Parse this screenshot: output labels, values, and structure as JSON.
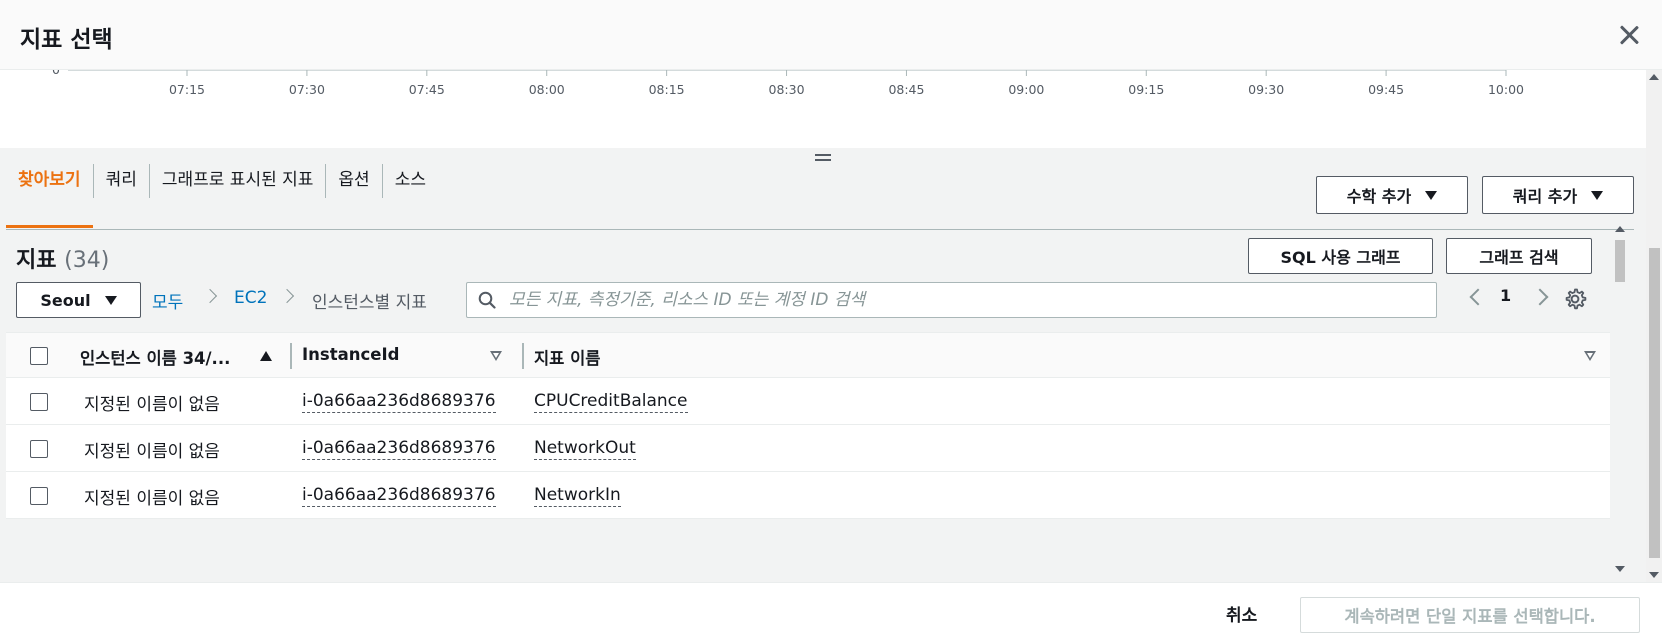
{
  "dialog": {
    "title": "지표 선택",
    "close_label": "×"
  },
  "chart": {
    "y_tick_zero": "0",
    "x_ticks": [
      "07:15",
      "07:30",
      "07:45",
      "08:00",
      "08:15",
      "08:30",
      "08:45",
      "09:00",
      "09:15",
      "09:30",
      "09:45",
      "10:00"
    ]
  },
  "tabs": [
    {
      "label": "찾아보기",
      "active": true
    },
    {
      "label": "쿼리",
      "active": false
    },
    {
      "label": "그래프로 표시된 지표",
      "active": false
    },
    {
      "label": "옵션",
      "active": false
    },
    {
      "label": "소스",
      "active": false
    }
  ],
  "actions": {
    "math_label": "수학 추가",
    "query_label": "쿼리 추가"
  },
  "metrics": {
    "title": "지표",
    "count": "(34)",
    "sql_graph_button": "SQL 사용 그래프",
    "graph_search_button": "그래프 검색",
    "region": "Seoul",
    "breadcrumb": {
      "all": "모두",
      "namespace": "EC2",
      "dimension": "인스턴스별 지표"
    },
    "search_placeholder": "모든 지표, 측정기준, 리소스 ID 또는 계정 ID 검색",
    "page_number": "1"
  },
  "table": {
    "columns": [
      "인스턴스 이름 34/...",
      "InstanceId",
      "지표 이름"
    ],
    "rows": [
      {
        "name": "지정된 이름이 없음",
        "instance_id": "i-0a66aa236d8689376",
        "metric": "CPUCreditBalance"
      },
      {
        "name": "지정된 이름이 없음",
        "instance_id": "i-0a66aa236d8689376",
        "metric": "NetworkOut"
      },
      {
        "name": "지정된 이름이 없음",
        "instance_id": "i-0a66aa236d8689376",
        "metric": "NetworkIn"
      }
    ]
  },
  "footer": {
    "cancel_label": "취소",
    "primary_label": "계속하려면 단일 지표를 선택합니다."
  },
  "colors": {
    "accent": "#ec7211",
    "link": "#0073bb",
    "panel_bg": "#f2f3f3"
  }
}
